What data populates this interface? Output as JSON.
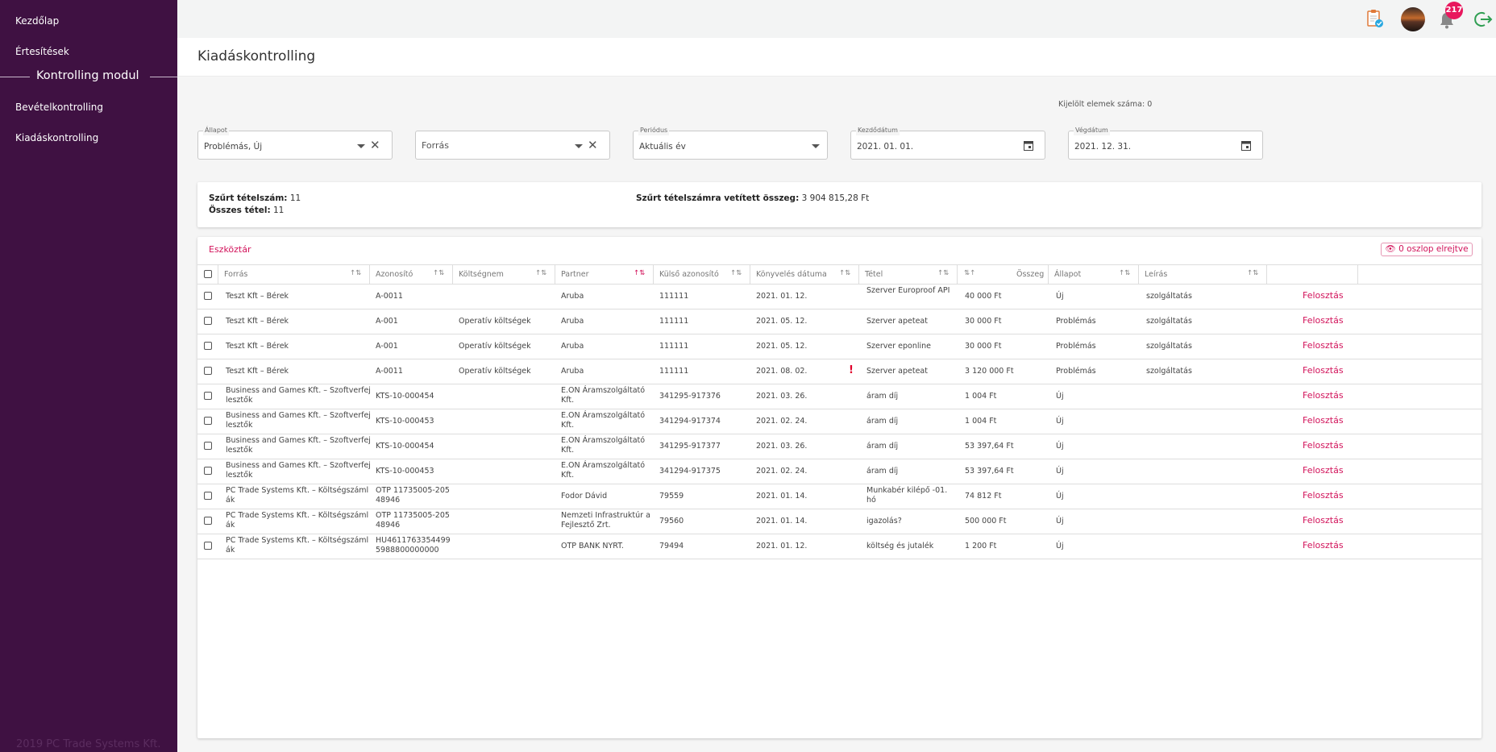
{
  "sidebar": {
    "items_top": [
      "Kezdőlap",
      "Értesítések"
    ],
    "module_title": "Kontrolling modul",
    "items_module": [
      "Bevételkontrolling",
      "Kiadáskontrolling"
    ],
    "footer": "2019 PC Trade Systems Kft."
  },
  "header": {
    "page_title": "Kiadáskontrolling",
    "notification_count": "217"
  },
  "filters": {
    "selected_count_label": "Kijelölt elemek száma: 0",
    "allapot": {
      "label": "Állapot",
      "value": "Problémás, Új"
    },
    "forras": {
      "placeholder": "Forrás"
    },
    "periodus": {
      "label": "Periódus",
      "value": "Aktuális év"
    },
    "kezdodatum": {
      "label": "Kezdődátum",
      "value": "2021. 01. 01."
    },
    "vegdatum": {
      "label": "Végdátum",
      "value": "2021. 12. 31."
    }
  },
  "summary": {
    "filtered_count_label": "Szűrt tételszám:",
    "filtered_count": "11",
    "total_label": "Összes tétel:",
    "total": "11",
    "sum_label": "Szűrt tételszámra vetített összeg:",
    "sum": "3 904 815,28 Ft"
  },
  "table": {
    "toolbar_label": "Eszköztár",
    "hidden_columns_label": "0 oszlop elrejtve",
    "columns": [
      "Forrás",
      "Azonosító",
      "Költségnem",
      "Partner",
      "Külső azonosító",
      "Könyvelés dátuma",
      "Tétel",
      "Összeg",
      "Állapot",
      "Leírás"
    ],
    "action_label": "Felosztás",
    "rows": [
      {
        "forras": "Teszt Kft – Bérek",
        "azonosito": "A-0011",
        "koltsegnem": "",
        "partner": "Aruba",
        "kulso": "111111",
        "datum": "2021. 01. 12.",
        "tetel": "Szerver Europroof API",
        "osszeg": "40 000 Ft",
        "allapot": "Új",
        "leiras": "szolgáltatás",
        "warning": ""
      },
      {
        "forras": "Teszt Kft – Bérek",
        "azonosito": "A-001",
        "koltsegnem": "Operatív költségek",
        "partner": "Aruba",
        "kulso": "111111",
        "datum": "2021. 05. 12.",
        "tetel": "Szerver apeteat",
        "osszeg": "30 000 Ft",
        "allapot": "Problémás",
        "leiras": "szolgáltatás",
        "warning": ""
      },
      {
        "forras": "Teszt Kft – Bérek",
        "azonosito": "A-001",
        "koltsegnem": "Operatív költségek",
        "partner": "Aruba",
        "kulso": "111111",
        "datum": "2021. 05. 12.",
        "tetel": "Szerver eponline",
        "osszeg": "30 000 Ft",
        "allapot": "Problémás",
        "leiras": "szolgáltatás",
        "warning": ""
      },
      {
        "forras": "Teszt Kft – Bérek",
        "azonosito": "A-0011",
        "koltsegnem": "Operatív költségek",
        "partner": "Aruba",
        "kulso": "111111",
        "datum": "2021. 08. 02.",
        "tetel": "Szerver apeteat",
        "osszeg": "3 120 000 Ft",
        "allapot": "Problémás",
        "leiras": "szolgáltatás",
        "warning": "!"
      },
      {
        "forras": "Business and Games Kft. – Szoftverfejlesztők",
        "azonosito": "KTS-10-000454",
        "koltsegnem": "",
        "partner": "E.ON Áramszolgáltató Kft.",
        "kulso": "341295-917376",
        "datum": "2021. 03. 26.",
        "tetel": "áram díj",
        "osszeg": "1 004 Ft",
        "allapot": "Új",
        "leiras": "",
        "warning": ""
      },
      {
        "forras": "Business and Games Kft. – Szoftverfejlesztők",
        "azonosito": "KTS-10-000453",
        "koltsegnem": "",
        "partner": "E.ON Áramszolgáltató Kft.",
        "kulso": "341294-917374",
        "datum": "2021. 02. 24.",
        "tetel": "áram díj",
        "osszeg": "1 004 Ft",
        "allapot": "Új",
        "leiras": "",
        "warning": ""
      },
      {
        "forras": "Business and Games Kft. – Szoftverfejlesztők",
        "azonosito": "KTS-10-000454",
        "koltsegnem": "",
        "partner": "E.ON Áramszolgáltató Kft.",
        "kulso": "341295-917377",
        "datum": "2021. 03. 26.",
        "tetel": "áram díj",
        "osszeg": "53 397,64 Ft",
        "allapot": "Új",
        "leiras": "",
        "warning": ""
      },
      {
        "forras": "Business and Games Kft. – Szoftverfejlesztők",
        "azonosito": "KTS-10-000453",
        "koltsegnem": "",
        "partner": "E.ON Áramszolgáltató Kft.",
        "kulso": "341294-917375",
        "datum": "2021. 02. 24.",
        "tetel": "áram díj",
        "osszeg": "53 397,64 Ft",
        "allapot": "Új",
        "leiras": "",
        "warning": ""
      },
      {
        "forras": "PC Trade Systems Kft. – Költségszámlák",
        "azonosito": "OTP 11735005-20548946",
        "koltsegnem": "",
        "partner": "Fodor Dávid",
        "kulso": "79559",
        "datum": "2021. 01. 14.",
        "tetel": "Munkabér kilépő -01.hó",
        "osszeg": "74 812 Ft",
        "allapot": "Új",
        "leiras": "",
        "warning": ""
      },
      {
        "forras": "PC Trade Systems Kft. – Költségszámlák",
        "azonosito": "OTP 11735005-20548946",
        "koltsegnem": "",
        "partner": "Nemzeti Infrastruktúr a Fejlesztő Zrt.",
        "kulso": "79560",
        "datum": "2021. 01. 14.",
        "tetel": "igazolás?",
        "osszeg": "500 000 Ft",
        "allapot": "Új",
        "leiras": "",
        "warning": ""
      },
      {
        "forras": "PC Trade Systems Kft. – Költségszámlák",
        "azonosito": "HU46117633544995988800000000",
        "koltsegnem": "",
        "partner": "OTP BANK NYRT.",
        "kulso": "79494",
        "datum": "2021. 01. 12.",
        "tetel": "költség és jutalék",
        "osszeg": "1 200 Ft",
        "allapot": "Új",
        "leiras": "",
        "warning": ""
      }
    ]
  }
}
